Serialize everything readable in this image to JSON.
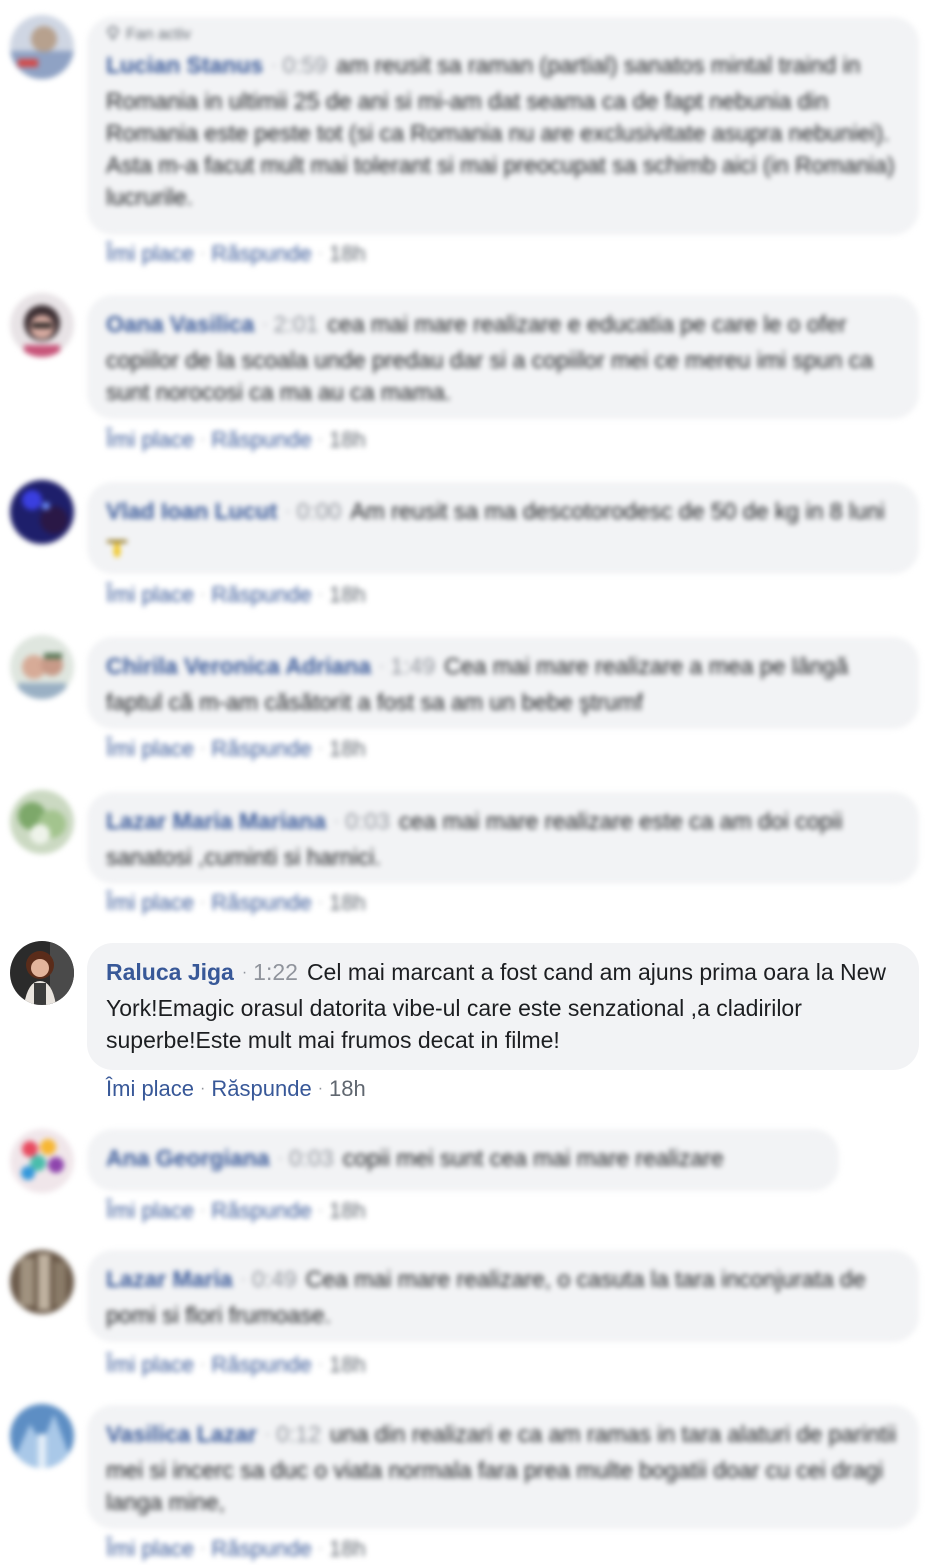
{
  "comments": [
    {
      "author": "Lucian Stanus",
      "duration": "0:59",
      "badge": "Fan activ",
      "text": "am reusit sa raman (partial) sanatos mintal traind in Romania in ultimii 25 de ani si mi-am dat seama ca de fapt nebunia din Romania este peste tot (si ca Romania nu are exclusivitate asupra nebuniei). Asta m-a facut mult mai tolerant si mai preocupat sa schimb aici (in Romania) lucrurile.",
      "like": "Îmi place",
      "reply": "Răspunde",
      "time": "18h"
    },
    {
      "author": "Oana Vasilica",
      "duration": "2:01",
      "text": "cea mai mare realizare e educatia pe care le o ofer copiilor de la scoala unde predau dar si a copiilor mei ce mereu imi spun ca sunt norocosi ca ma au ca mama.",
      "like": "Îmi place",
      "reply": "Răspunde",
      "time": "18h"
    },
    {
      "author": "Vlad Ioan Lucut",
      "duration": "0:00",
      "text": "Am reusit sa ma descotorodesc de 50 de kg in 8 luni",
      "emoji": "weightlifter-emoji",
      "like": "Îmi place",
      "reply": "Răspunde",
      "time": "18h"
    },
    {
      "author": "Chirila Veronica Adriana",
      "duration": "1:49",
      "text": "Cea mai mare realizare a mea pe lângă faptul că m-am căsătorit a fost sa am un bebe ştrumf",
      "like": "Îmi place",
      "reply": "Răspunde",
      "time": "18h"
    },
    {
      "author": "Lazar Maria Mariana",
      "duration": "0:03",
      "text": "cea mai mare realizare este ca am doi copii sanatosi ,cuminti si harnici.",
      "like": "Îmi place",
      "reply": "Răspunde",
      "time": "18h"
    },
    {
      "author": "Raluca Jiga",
      "duration": "1:22",
      "text": "Cel mai marcant a fost cand am ajuns prima oara la New York!Emagic orasul datorita vibe-ul care este senzational ,a cladirilor superbe!Este mult mai frumos decat in filme!",
      "like": "Îmi place",
      "reply": "Răspunde",
      "time": "18h"
    },
    {
      "author": "Ana Georgiana",
      "duration": "0:03",
      "text": "copii mei sunt cea mai mare realizare",
      "like": "Îmi place",
      "reply": "Răspunde",
      "time": "18h"
    },
    {
      "author": "Lazar Maria",
      "duration": "0:49",
      "text": "Cea mai mare realizare, o casuta la tara inconjurata de pomi si flori frumoase.",
      "like": "Îmi place",
      "reply": "Răspunde",
      "time": "18h"
    },
    {
      "author": "Vasilica Lazar",
      "duration": "0:12",
      "text": "una din realizari e ca am ramas in tara alaturi de parintii mei si incerc sa duc o viata normala fara prea multe bogatii doar cu cei dragi langa mine,",
      "like": "Îmi place",
      "reply": "Răspunde",
      "time": "18h"
    }
  ],
  "colors": {
    "author": "#385898",
    "bubble": "#f2f3f5",
    "meta": "#90949c",
    "text": "#1c1e21"
  }
}
